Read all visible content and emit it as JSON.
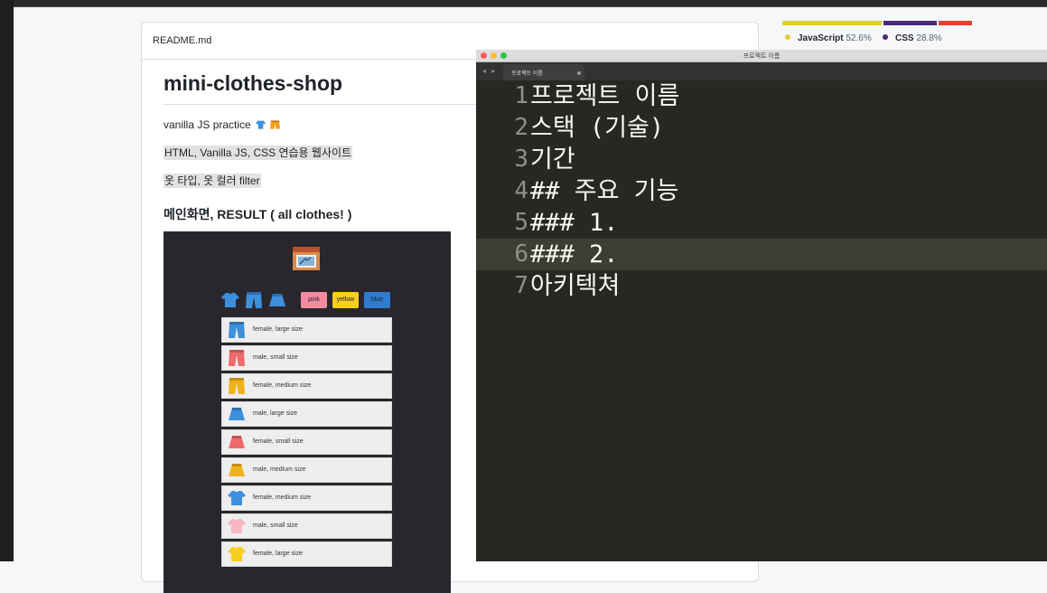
{
  "readme": {
    "filename": "README.md",
    "title": "mini-clothes-shop",
    "description": "vanilla JS practice",
    "desc_icons": [
      "tshirt-emoji",
      "shorts-emoji"
    ],
    "tech_line": "HTML, Vanilla JS, CSS 연습용 웹사이트",
    "filter_line": "옷 타입, 옷 컬러 filter",
    "section_heading": "메인화면, RESULT ( all clothes! )",
    "screenshot": {
      "color_buttons": [
        {
          "label": "pink",
          "color": "#f48aa0"
        },
        {
          "label": "yellow",
          "color": "#f7cf1f"
        },
        {
          "label": "blue",
          "color": "#2f7bd0"
        }
      ],
      "items": [
        {
          "text": "female, large size",
          "icon": "pants-icon",
          "color": "#3c90dd"
        },
        {
          "text": "male, small size",
          "icon": "pants-icon",
          "color": "#ef6b6b"
        },
        {
          "text": "female, medium size",
          "icon": "pants-icon",
          "color": "#f2b21e"
        },
        {
          "text": "male, large size",
          "icon": "skirt-icon",
          "color": "#3c90dd"
        },
        {
          "text": "female, small size",
          "icon": "skirt-icon",
          "color": "#ef6b6b"
        },
        {
          "text": "male, medium size",
          "icon": "skirt-icon",
          "color": "#f2b21e"
        },
        {
          "text": "female, medium size",
          "icon": "tshirt-icon",
          "color": "#3c90dd"
        },
        {
          "text": "male, small size",
          "icon": "tshirt-icon",
          "color": "#f6b6c4"
        },
        {
          "text": "female, large size",
          "icon": "tshirt-icon",
          "color": "#f7cf1f"
        }
      ]
    }
  },
  "languages": [
    {
      "name": "JavaScript",
      "percent": "52.6%",
      "share": 0.526,
      "color": "#e4cd3a"
    },
    {
      "name": "CSS",
      "percent": "28.8%",
      "share": 0.288,
      "color": "#4a2a78"
    },
    {
      "name": "",
      "percent": "",
      "share": 0.186,
      "color": "#e2442b"
    }
  ],
  "editor": {
    "window_title": "프로젝트 이름",
    "tab_label": "프로젝트 이름",
    "active_line": 6,
    "lines": [
      {
        "num": "1",
        "text": "프로젝트 이름"
      },
      {
        "num": "2",
        "text": "스택 (기술)"
      },
      {
        "num": "3",
        "text": "기간"
      },
      {
        "num": "4",
        "text": "## 주요 기능"
      },
      {
        "num": "5",
        "text": "### 1."
      },
      {
        "num": "6",
        "text": "### 2."
      },
      {
        "num": "7",
        "text": "아키텍쳐"
      }
    ]
  }
}
